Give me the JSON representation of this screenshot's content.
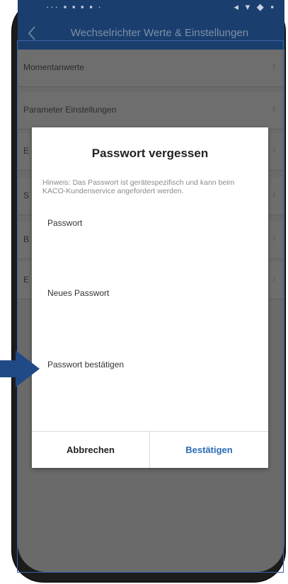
{
  "statusbar": {
    "left": "··· ▪ ▪ ▪ ▪ ·",
    "right": "◂ ▾ ◆ ▪"
  },
  "appbar": {
    "title": "Wechselrichter Werte & Einstellungen"
  },
  "list": {
    "items": [
      {
        "label": "Momentanwerte"
      },
      {
        "label": "Parameter Einstellungen"
      },
      {
        "label": "E"
      },
      {
        "label": "S"
      },
      {
        "label": "B"
      },
      {
        "label": "E"
      }
    ]
  },
  "dialog": {
    "title": "Passwort vergessen",
    "hint": "Hinweis: Das Passwort ist gerätespezifisch und kann beim KACO-Kundenservice angefordert werden.",
    "fields": [
      {
        "label": "Passwort",
        "value": ""
      },
      {
        "label": "Neues Passwort",
        "value": ""
      },
      {
        "label": "Passwort bestätigen",
        "value": ""
      }
    ],
    "cancel_label": "Abbrechen",
    "confirm_label": "Bestätigen"
  },
  "colors": {
    "appbar": "#1a3f6e",
    "overlay": "#6a6a6a",
    "confirm": "#2a6bb3",
    "arrow": "#1f4a86"
  },
  "icons": {
    "back": "chevron-left-icon",
    "row": "chevron-right-icon",
    "pointer": "arrow-right-icon"
  }
}
